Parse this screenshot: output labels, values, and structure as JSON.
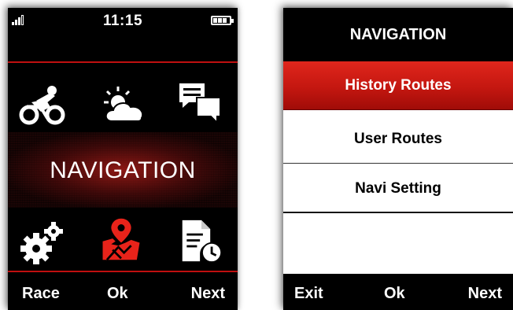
{
  "left_screen": {
    "status": {
      "time": "11:15"
    },
    "icons": [
      {
        "name": "cyclist-icon"
      },
      {
        "name": "weather-icon"
      },
      {
        "name": "messages-icon"
      },
      {
        "name": "settings-icon"
      },
      {
        "name": "map-navigation-icon"
      },
      {
        "name": "history-file-icon"
      }
    ],
    "title": "NAVIGATION",
    "softkeys": {
      "left": "Race",
      "center": "Ok",
      "right": "Next"
    },
    "colors": {
      "accent": "#c01010",
      "highlight_icon": "#e8231a"
    }
  },
  "right_screen": {
    "header": "NAVIGATION",
    "menu_items": [
      {
        "label": "History Routes",
        "selected": true
      },
      {
        "label": "User Routes",
        "selected": false
      },
      {
        "label": "Navi Setting",
        "selected": false
      }
    ],
    "softkeys": {
      "left": "Exit",
      "center": "Ok",
      "right": "Next"
    },
    "colors": {
      "selected_bg": "#c41710"
    }
  }
}
